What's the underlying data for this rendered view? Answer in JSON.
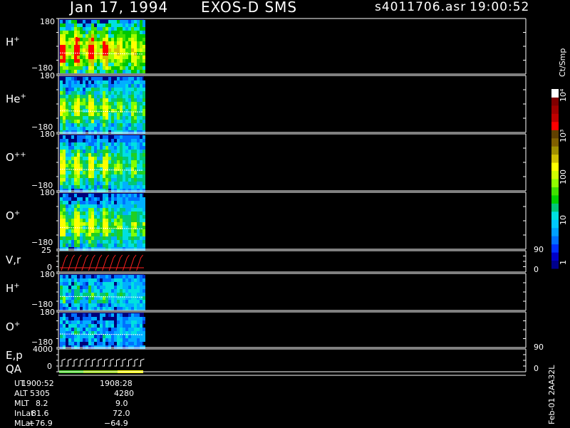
{
  "header": {
    "date": "Jan 17, 1994",
    "mission": "EXOS-D SMS",
    "file": "s4011706.asr",
    "time": "19:00:52"
  },
  "chart_data": {
    "type": "heatmap",
    "panels": [
      {
        "label": "H",
        "superscript": "+",
        "ymax": "180",
        "ymin": "−180",
        "has_data": true
      },
      {
        "label": "He",
        "superscript": "+",
        "ymax": "180",
        "ymin": "−180",
        "has_data": true
      },
      {
        "label": "O",
        "superscript": "++",
        "ymax": "180",
        "ymin": "−180",
        "has_data": true
      },
      {
        "label": "O",
        "superscript": "+",
        "ymax": "180",
        "ymin": "−180",
        "has_data": true
      },
      {
        "label": "V,r",
        "ymax": "25",
        "ymin": "0",
        "right_top": "90",
        "right_bottom": "0"
      },
      {
        "label": "H",
        "superscript": "+",
        "ymax": "180",
        "ymin": "−180"
      },
      {
        "label": "O",
        "superscript": "+",
        "ymax": "180",
        "ymin": "−180"
      },
      {
        "label": "E,p",
        "label2": "QA",
        "ymax": "4000",
        "ymin": "0",
        "right_top": "90",
        "right_bottom": "0"
      }
    ],
    "colorbar": {
      "unit": "Ct/Smp",
      "ticks": [
        "1",
        "10",
        "100",
        "10³",
        "10⁴"
      ],
      "colors": [
        "#00008b",
        "#0000c8",
        "#0030ff",
        "#0070ff",
        "#00a0ff",
        "#00c8ff",
        "#00e0e0",
        "#00c878",
        "#00d000",
        "#40e000",
        "#90ff00",
        "#d0ff00",
        "#ffff00",
        "#d0c000",
        "#a09000",
        "#806000",
        "#604000",
        "#ff0000",
        "#c00000",
        "#a00000",
        "#800000",
        "#ffffff"
      ]
    }
  },
  "footer": {
    "rows": [
      {
        "label": "UT",
        "v1": "1900:52",
        "v2": "1908:28"
      },
      {
        "label": "ALT",
        "v1": "5305",
        "v2": "4280"
      },
      {
        "label": "MLT",
        "v1": "8.2",
        "v2": "9.0"
      },
      {
        "label": "InLat",
        "v1": "81.6",
        "v2": "72.0"
      },
      {
        "label": "MLat",
        "v1": "−76.9",
        "v2": "−64.9"
      }
    ],
    "corner_text": "Feb-01 2AA32L"
  }
}
